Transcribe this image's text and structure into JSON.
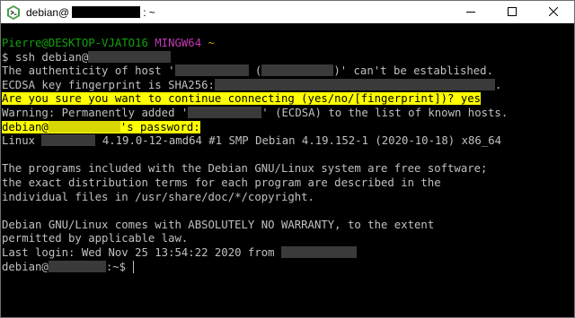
{
  "window": {
    "title_prefix": "debian@",
    "title_suffix": ": ~",
    "icon": "mingw-bash-icon",
    "controls": [
      "minimize-icon",
      "maximize-icon",
      "close-icon"
    ]
  },
  "terminal": {
    "prompt_user_host": "Pierre@DESKTOP-VJATO16",
    "prompt_env": "MINGW64",
    "prompt_dir": "~",
    "prompt_symbol": "$",
    "command": "ssh debian@",
    "auth_1": "The authenticity of host '",
    "auth_2": " (",
    "auth_3": ")' can't be established.",
    "fingerprint_label": "ECDSA key fingerprint is SHA256:",
    "fingerprint_end": ".",
    "confirm_question": "Are you sure you want to continue connecting (yes/no/[fingerprint])? yes",
    "warning_1": "Warning: Permanently added '",
    "warning_2": "' (ECDSA) to the list of known hosts.",
    "password_user": "debian@",
    "password_prompt": "'s password:",
    "linux_1": "Linux ",
    "linux_2": " 4.19.0-12-amd64 #1 SMP Debian 4.19.152-1 (2020-10-18) x86_64",
    "motd_1": "The programs included with the Debian GNU/Linux system are free software;",
    "motd_2": "the exact distribution terms for each program are described in the",
    "motd_3": "individual files in /usr/share/doc/*/copyright.",
    "motd_4": "Debian GNU/Linux comes with ABSOLUTELY NO WARRANTY, to the extent",
    "motd_5": "permitted by applicable law.",
    "last_login": "Last login: Wed Nov 25 13:54:22 2020 from ",
    "final_prompt_user": "debian@",
    "final_prompt_rest": ":~$"
  }
}
